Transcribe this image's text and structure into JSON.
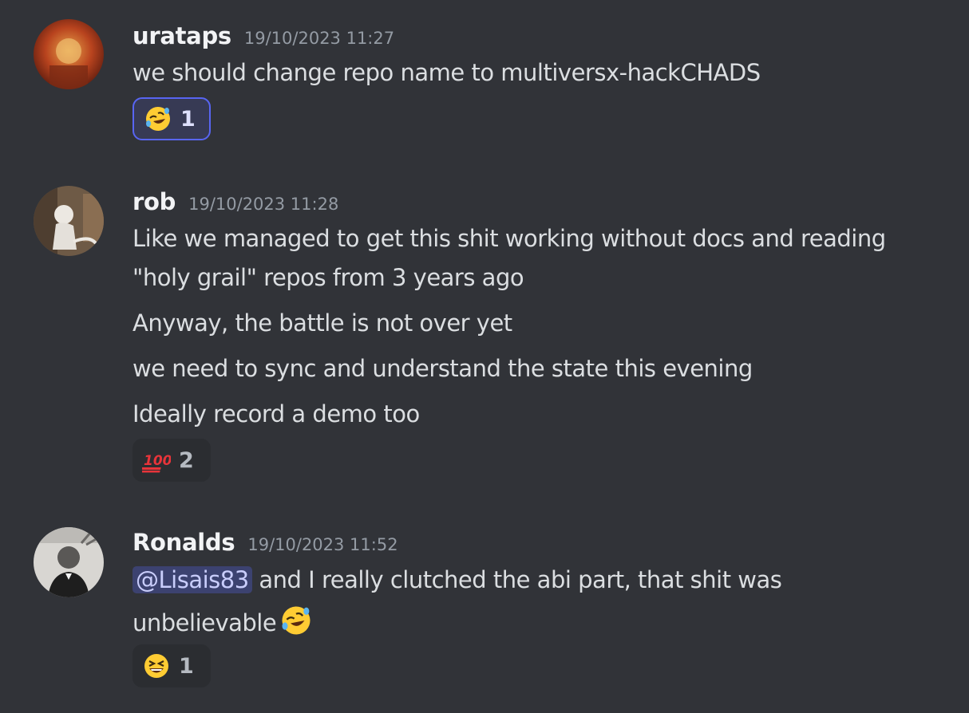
{
  "messages": [
    {
      "username": "urataps",
      "timestamp": "19/10/2023 11:27",
      "lines": [
        "we should change repo name to multiversx-hackCHADS"
      ],
      "reaction": {
        "emoji": "rolling-on-floor-laughing",
        "count": "1",
        "active": true
      }
    },
    {
      "username": "rob",
      "timestamp": "19/10/2023 11:28",
      "lines": [
        "Like we managed to get this shit working without docs and reading",
        "\"holy grail\" repos from 3 years ago",
        "Anyway, the battle is not over yet",
        "we need to sync and understand the state this evening",
        "Ideally record a demo too"
      ],
      "reaction": {
        "emoji": "hundred-points",
        "count": "2",
        "active": false
      }
    },
    {
      "username": "Ronalds",
      "timestamp": "19/10/2023 11:52",
      "mention": "@Lisais83",
      "lines": [
        "and I really clutched the abi part, that shit was",
        "unbelievable"
      ],
      "inline_emoji": "rolling-on-floor-laughing",
      "reaction": {
        "emoji": "grinning-squinting-face",
        "count": "1",
        "active": false
      }
    }
  ],
  "colors": {
    "background": "#313338",
    "reaction_bg": "#2b2d31",
    "reaction_active_border": "#5865f2",
    "mention_bg": "#3c4270"
  }
}
